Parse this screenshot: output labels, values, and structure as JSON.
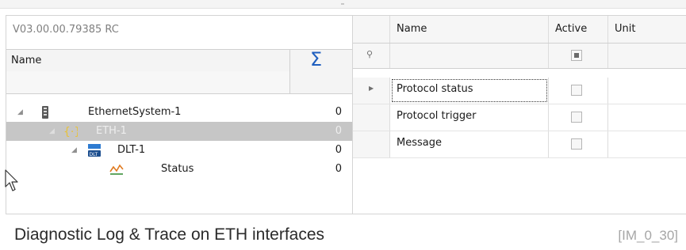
{
  "version": "V03.00.00.79385 RC",
  "left_panel": {
    "header": {
      "name": "Name",
      "sum_icon": "sigma-icon"
    },
    "tree": [
      {
        "label": "EthernetSystem-1",
        "count": "0",
        "icon": "ethernet-system-icon",
        "expanded": true,
        "selected": false
      },
      {
        "label": "ETH-1",
        "count": "0",
        "icon": "eth-interface-icon",
        "expanded": true,
        "selected": true
      },
      {
        "label": "DLT-1",
        "count": "0",
        "icon": "dlt-icon",
        "expanded": true,
        "selected": false
      },
      {
        "label": "Status",
        "count": "0",
        "icon": "status-icon",
        "expanded": false,
        "selected": false
      }
    ]
  },
  "right_panel": {
    "columns": {
      "name": "Name",
      "active": "Active",
      "unit": "Unit"
    },
    "filter_icon": "pin-icon",
    "rows": [
      {
        "name": "Protocol status",
        "active": false,
        "current": true
      },
      {
        "name": "Protocol trigger",
        "active": false,
        "current": false
      },
      {
        "name": "Message",
        "active": false,
        "current": false
      }
    ]
  },
  "caption": "Diagnostic Log & Trace on ETH interfaces",
  "reference": "[IM_0_30]",
  "colors": {
    "accent": "#1f5fbf",
    "selected_row": "#c6c6c6"
  }
}
